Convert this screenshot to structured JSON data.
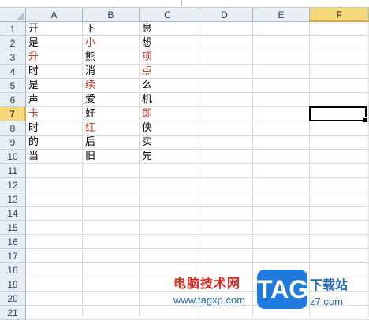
{
  "columns": [
    "A",
    "B",
    "C",
    "D",
    "E",
    "F"
  ],
  "active_column": "F",
  "rows": [
    "1",
    "2",
    "3",
    "4",
    "5",
    "6",
    "7",
    "8",
    "9",
    "10",
    "11",
    "12",
    "13",
    "14",
    "15",
    "16",
    "17",
    "18",
    "19",
    "20",
    "21"
  ],
  "active_row": "7",
  "selected_cell": "F7",
  "data": [
    [
      {
        "v": "开",
        "c": "#000000"
      },
      {
        "v": "下",
        "c": "#000000"
      },
      {
        "v": "息",
        "c": "#000000"
      }
    ],
    [
      {
        "v": "是",
        "c": "#000000"
      },
      {
        "v": "小",
        "c": "#c0392b"
      },
      {
        "v": "想",
        "c": "#000000"
      }
    ],
    [
      {
        "v": "升",
        "c": "#c0392b"
      },
      {
        "v": "熊",
        "c": "#000000"
      },
      {
        "v": "项",
        "c": "#c0392b"
      }
    ],
    [
      {
        "v": "时",
        "c": "#000000"
      },
      {
        "v": "消",
        "c": "#000000"
      },
      {
        "v": "点",
        "c": "#c0392b"
      }
    ],
    [
      {
        "v": "是",
        "c": "#000000"
      },
      {
        "v": "续",
        "c": "#c0392b"
      },
      {
        "v": "么",
        "c": "#000000"
      }
    ],
    [
      {
        "v": "声",
        "c": "#000000"
      },
      {
        "v": "爱",
        "c": "#000000"
      },
      {
        "v": "机",
        "c": "#000000"
      }
    ],
    [
      {
        "v": "卡",
        "c": "#c0392b"
      },
      {
        "v": "好",
        "c": "#000000"
      },
      {
        "v": "即",
        "c": "#c0392b"
      }
    ],
    [
      {
        "v": "时",
        "c": "#000000"
      },
      {
        "v": "红",
        "c": "#c0392b"
      },
      {
        "v": "侠",
        "c": "#000000"
      }
    ],
    [
      {
        "v": "的",
        "c": "#000000"
      },
      {
        "v": "后",
        "c": "#000000"
      },
      {
        "v": "实",
        "c": "#000000"
      }
    ],
    [
      {
        "v": "当",
        "c": "#000000"
      },
      {
        "v": "旧",
        "c": "#000000"
      },
      {
        "v": "先",
        "c": "#000000"
      }
    ]
  ],
  "watermark": {
    "title": "电脑技术网",
    "url": "www.tagxp.com",
    "logo_text": "TAG",
    "right_text": "下载站",
    "right_url": "z7.com"
  }
}
